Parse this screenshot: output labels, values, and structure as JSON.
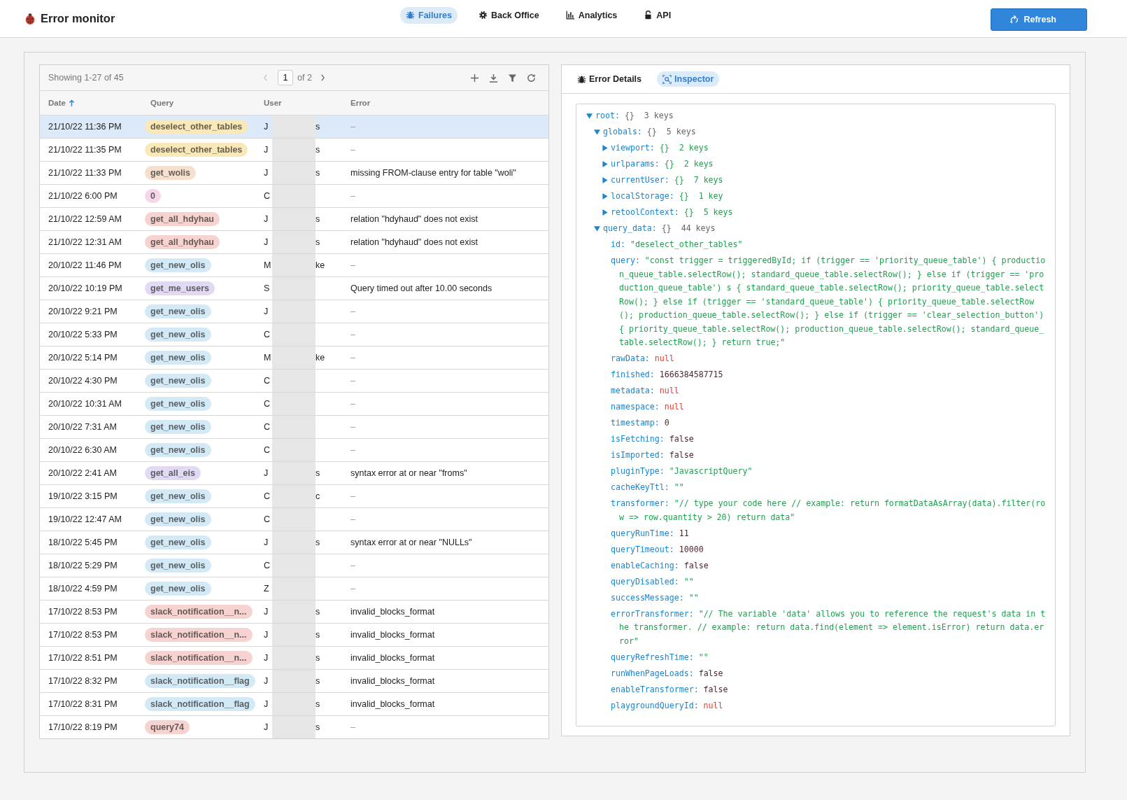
{
  "app": {
    "title": "Error monitor"
  },
  "nav": [
    {
      "label": "Failures",
      "selected": true
    },
    {
      "label": "Back Office",
      "selected": false
    },
    {
      "label": "Analytics",
      "selected": false
    },
    {
      "label": "API",
      "selected": false
    }
  ],
  "refresh_button": "Refresh",
  "table": {
    "showing": "Showing 1-27 of 45",
    "page": "1",
    "of_pages": "of 2",
    "columns": [
      {
        "label": "Date",
        "sorted": true
      },
      {
        "label": "Query",
        "sorted": false
      },
      {
        "label": "User",
        "sorted": false
      },
      {
        "label": "Error",
        "sorted": false
      }
    ],
    "rows": [
      {
        "date": "21/10/22 11:36 PM",
        "query": "deselect_other_tables",
        "color": "#f9e8b8",
        "user_start": "J",
        "user_end": "s",
        "error": "–",
        "selected": true
      },
      {
        "date": "21/10/22 11:35 PM",
        "query": "deselect_other_tables",
        "color": "#f9e8b8",
        "user_start": "J",
        "user_end": "s",
        "error": "–",
        "selected": false
      },
      {
        "date": "21/10/22 11:33 PM",
        "query": "get_wolis",
        "color": "#f6dfcc",
        "user_start": "J",
        "user_end": "s",
        "error": "missing FROM-clause entry for table \"woli\"",
        "selected": false
      },
      {
        "date": "21/10/22 6:00 PM",
        "query": "0",
        "color": "#f8d6ea",
        "user_start": "C",
        "user_end": "",
        "error": "–",
        "selected": false
      },
      {
        "date": "21/10/22 12:59 AM",
        "query": "get_all_hdyhau",
        "color": "#f6d3d0",
        "user_start": "J",
        "user_end": "s",
        "error": "relation \"hdyhaud\" does not exist",
        "selected": false
      },
      {
        "date": "21/10/22 12:31 AM",
        "query": "get_all_hdyhau",
        "color": "#f6d3d0",
        "user_start": "J",
        "user_end": "s",
        "error": "relation \"hdyhaud\" does not exist",
        "selected": false
      },
      {
        "date": "20/10/22 11:46 PM",
        "query": "get_new_olis",
        "color": "#d3e9f6",
        "user_start": "M",
        "user_end": "ke",
        "error": "–",
        "selected": false
      },
      {
        "date": "20/10/22 10:19 PM",
        "query": "get_me_users",
        "color": "#e2daf3",
        "user_start": "S",
        "user_end": "",
        "error": "Query timed out after 10.00 seconds",
        "selected": false
      },
      {
        "date": "20/10/22 9:21 PM",
        "query": "get_new_olis",
        "color": "#d3e9f6",
        "user_start": "J",
        "user_end": "",
        "error": "–",
        "selected": false
      },
      {
        "date": "20/10/22 5:33 PM",
        "query": "get_new_olis",
        "color": "#d3e9f6",
        "user_start": "C",
        "user_end": "",
        "error": "–",
        "selected": false
      },
      {
        "date": "20/10/22 5:14 PM",
        "query": "get_new_olis",
        "color": "#d3e9f6",
        "user_start": "M",
        "user_end": "ke",
        "error": "–",
        "selected": false
      },
      {
        "date": "20/10/22 4:30 PM",
        "query": "get_new_olis",
        "color": "#d3e9f6",
        "user_start": "C",
        "user_end": "",
        "error": "–",
        "selected": false
      },
      {
        "date": "20/10/22 10:31 AM",
        "query": "get_new_olis",
        "color": "#d3e9f6",
        "user_start": "C",
        "user_end": "",
        "error": "–",
        "selected": false
      },
      {
        "date": "20/10/22 7:31 AM",
        "query": "get_new_olis",
        "color": "#d3e9f6",
        "user_start": "C",
        "user_end": "",
        "error": "–",
        "selected": false
      },
      {
        "date": "20/10/22 6:30 AM",
        "query": "get_new_olis",
        "color": "#d3e9f6",
        "user_start": "C",
        "user_end": "",
        "error": "–",
        "selected": false
      },
      {
        "date": "20/10/22 2:41 AM",
        "query": "get_all_eis",
        "color": "#e2daf3",
        "user_start": "J",
        "user_end": "s",
        "error": "syntax error at or near \"froms\"",
        "selected": false
      },
      {
        "date": "19/10/22 3:15 PM",
        "query": "get_new_olis",
        "color": "#d3e9f6",
        "user_start": "C",
        "user_end": "c",
        "error": "–",
        "selected": false
      },
      {
        "date": "19/10/22 12:47 AM",
        "query": "get_new_olis",
        "color": "#d3e9f6",
        "user_start": "C",
        "user_end": "",
        "error": "–",
        "selected": false
      },
      {
        "date": "18/10/22 5:45 PM",
        "query": "get_new_olis",
        "color": "#d3e9f6",
        "user_start": "J",
        "user_end": "s",
        "error": "syntax error at or near \"NULLs\"",
        "selected": false
      },
      {
        "date": "18/10/22 5:29 PM",
        "query": "get_new_olis",
        "color": "#d3e9f6",
        "user_start": "C",
        "user_end": "",
        "error": "–",
        "selected": false
      },
      {
        "date": "18/10/22 4:59 PM",
        "query": "get_new_olis",
        "color": "#d3e9f6",
        "user_start": "Z",
        "user_end": "",
        "error": "–",
        "selected": false
      },
      {
        "date": "17/10/22 8:53 PM",
        "query": "slack_notification__n...",
        "color": "#f6d3d0",
        "user_start": "J",
        "user_end": "s",
        "error": "invalid_blocks_format",
        "selected": false
      },
      {
        "date": "17/10/22 8:53 PM",
        "query": "slack_notification__n...",
        "color": "#f6d3d0",
        "user_start": "J",
        "user_end": "s",
        "error": "invalid_blocks_format",
        "selected": false
      },
      {
        "date": "17/10/22 8:51 PM",
        "query": "slack_notification__n...",
        "color": "#f6d3d0",
        "user_start": "J",
        "user_end": "s",
        "error": "invalid_blocks_format",
        "selected": false
      },
      {
        "date": "17/10/22 8:32 PM",
        "query": "slack_notification__flag",
        "color": "#d3e9f6",
        "user_start": "J",
        "user_end": "s",
        "error": "invalid_blocks_format",
        "selected": false
      },
      {
        "date": "17/10/22 8:31 PM",
        "query": "slack_notification__flag",
        "color": "#d3e9f6",
        "user_start": "J",
        "user_end": "s",
        "error": "invalid_blocks_format",
        "selected": false
      },
      {
        "date": "17/10/22 8:19 PM",
        "query": "query74",
        "color": "#f6d3d0",
        "user_start": "J",
        "user_end": "s",
        "error": "–",
        "selected": false
      }
    ]
  },
  "detail_tabs": [
    {
      "label": "Error Details",
      "selected": false
    },
    {
      "label": "Inspector",
      "selected": true
    }
  ],
  "inspector": {
    "tree": [
      {
        "key": "root:",
        "summary": "{}  3 keys",
        "expanded": true,
        "children": [
          {
            "key": "globals:",
            "summary": "{}  5 keys",
            "expanded": true,
            "children": [
              {
                "key": "viewport:",
                "summary": "{}  2 keys",
                "expanded": false
              },
              {
                "key": "urlparams:",
                "summary": "{}  2 keys",
                "expanded": false
              },
              {
                "key": "currentUser:",
                "summary": "{}  7 keys",
                "expanded": false
              },
              {
                "key": "localStorage:",
                "summary": "{}  1 key",
                "expanded": false
              },
              {
                "key": "retoolContext:",
                "summary": "{}  5 keys",
                "expanded": false
              }
            ]
          },
          {
            "key": "query_data:",
            "summary": "{}  44 keys",
            "expanded": true,
            "children": [
              {
                "key": "id:",
                "value": "\"deselect_other_tables\"",
                "kind": "string"
              },
              {
                "key": "query:",
                "value": "\"const trigger = triggeredById; if (trigger == 'priority_queue_table') { production_queue_table.selectRow(); standard_queue_table.selectRow(); } else if (trigger == 'production_queue_table') s { standard_queue_table.selectRow(); priority_queue_table.selectRow(); } else if (trigger == 'standard_queue_table') { priority_queue_table.selectRow(); production_queue_table.selectRow(); } else if (trigger == 'clear_selection_button') { priority_queue_table.selectRow(); production_queue_table.selectRow(); standard_queue_table.selectRow(); } return true;\"",
                "kind": "string"
              },
              {
                "key": "rawData:",
                "value": "null",
                "kind": "null"
              },
              {
                "key": "finished:",
                "value": "1666384587715",
                "kind": "number"
              },
              {
                "key": "metadata:",
                "value": "null",
                "kind": "null"
              },
              {
                "key": "namespace:",
                "value": "null",
                "kind": "null"
              },
              {
                "key": "timestamp:",
                "value": "0",
                "kind": "number"
              },
              {
                "key": "isFetching:",
                "value": "false",
                "kind": "boolean"
              },
              {
                "key": "isImported:",
                "value": "false",
                "kind": "boolean"
              },
              {
                "key": "pluginType:",
                "value": "\"JavascriptQuery\"",
                "kind": "string"
              },
              {
                "key": "cacheKeyTtl:",
                "value": "\"\"",
                "kind": "string"
              },
              {
                "key": "transformer:",
                "value": "\"// type your code here // example: return formatDataAsArray(data).filter(row => row.quantity > 20) return data\"",
                "kind": "string"
              },
              {
                "key": "queryRunTime:",
                "value": "11",
                "kind": "number"
              },
              {
                "key": "queryTimeout:",
                "value": "10000",
                "kind": "number"
              },
              {
                "key": "enableCaching:",
                "value": "false",
                "kind": "boolean"
              },
              {
                "key": "queryDisabled:",
                "value": "\"\"",
                "kind": "string"
              },
              {
                "key": "successMessage:",
                "value": "\"\"",
                "kind": "string"
              },
              {
                "key": "errorTransformer:",
                "value": "\"// The variable 'data' allows you to reference the request's data in the transformer. // example: return data.find(element => element.isError) return data.error\"",
                "kind": "string"
              },
              {
                "key": "queryRefreshTime:",
                "value": "\"\"",
                "kind": "string"
              },
              {
                "key": "runWhenPageLoads:",
                "value": "false",
                "kind": "boolean"
              },
              {
                "key": "enableTransformer:",
                "value": "false",
                "kind": "boolean"
              },
              {
                "key": "playgroundQueryId:",
                "value": "null",
                "kind": "null"
              }
            ]
          }
        ]
      }
    ]
  }
}
